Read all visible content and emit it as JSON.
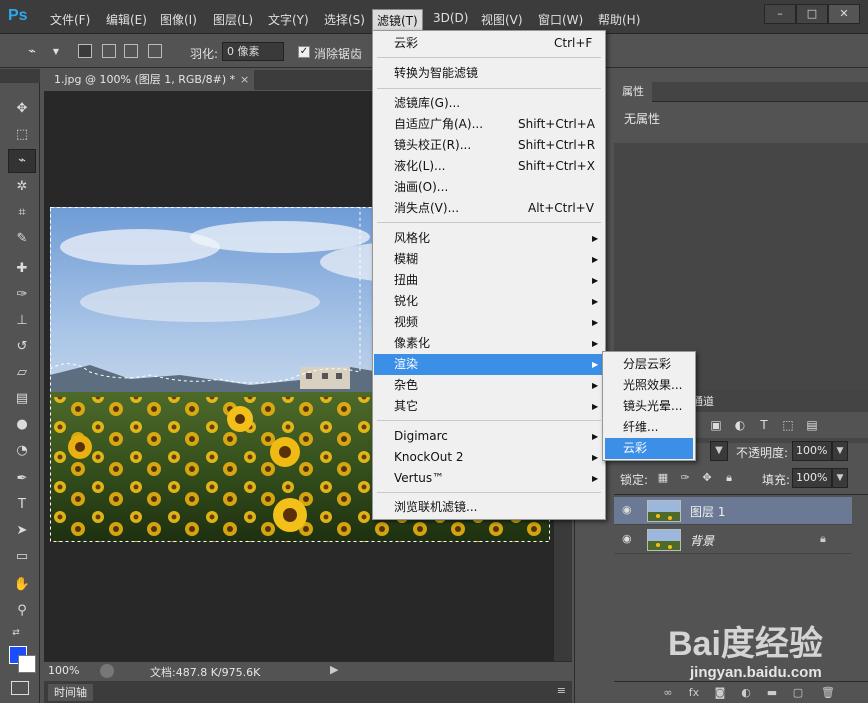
{
  "app": {
    "logo": "Ps",
    "window_controls": [
      "–",
      "□",
      "✕"
    ]
  },
  "menubar": {
    "items": [
      "文件(F)",
      "编辑(E)",
      "图像(I)",
      "图层(L)",
      "文字(Y)",
      "选择(S)",
      "滤镜(T)",
      "3D(D)",
      "视图(V)",
      "窗口(W)",
      "帮助(H)"
    ],
    "active_index": 6
  },
  "options": {
    "feather_label": "羽化:",
    "feather_value": "0 像素",
    "antialias_label": "消除锯齿",
    "antialias_checked": true
  },
  "document": {
    "tab_title": "1.jpg @ 100% (图层 1, RGB/8#) *",
    "tab_close": "×",
    "zoom": "100%",
    "doc_size": "文档:487.8 K/975.6K",
    "timeline_tab": "时间轴"
  },
  "filter_menu": {
    "groups": [
      [
        {
          "label": "云彩",
          "shortcut": "Ctrl+F"
        }
      ],
      [
        {
          "label": "转换为智能滤镜"
        }
      ],
      [
        {
          "label": "滤镜库(G)..."
        },
        {
          "label": "自适应广角(A)...",
          "shortcut": "Shift+Ctrl+A"
        },
        {
          "label": "镜头校正(R)...",
          "shortcut": "Shift+Ctrl+R"
        },
        {
          "label": "液化(L)...",
          "shortcut": "Shift+Ctrl+X"
        },
        {
          "label": "油画(O)..."
        },
        {
          "label": "消失点(V)...",
          "shortcut": "Alt+Ctrl+V"
        }
      ],
      [
        {
          "label": "风格化",
          "submenu": true
        },
        {
          "label": "模糊",
          "submenu": true
        },
        {
          "label": "扭曲",
          "submenu": true
        },
        {
          "label": "锐化",
          "submenu": true
        },
        {
          "label": "视频",
          "submenu": true
        },
        {
          "label": "像素化",
          "submenu": true
        },
        {
          "label": "渲染",
          "submenu": true,
          "highlight": true
        },
        {
          "label": "杂色",
          "submenu": true
        },
        {
          "label": "其它",
          "submenu": true
        }
      ],
      [
        {
          "label": "Digimarc",
          "submenu": true
        },
        {
          "label": "KnockOut 2",
          "submenu": true
        },
        {
          "label": "Vertus™",
          "submenu": true
        }
      ],
      [
        {
          "label": "浏览联机滤镜..."
        }
      ]
    ]
  },
  "render_submenu": {
    "items": [
      "分层云彩",
      "光照效果...",
      "镜头光晕...",
      "纤维...",
      "云彩"
    ],
    "highlight_index": 4
  },
  "properties": {
    "tab": "属性",
    "value": "无属性"
  },
  "layers": {
    "tab": "通道",
    "opacity_label": "不透明度:",
    "opacity_value": "100%",
    "lock_label": "锁定:",
    "fill_label": "填充:",
    "fill_value": "100%",
    "items": [
      {
        "name": "图层 1",
        "selected": true
      },
      {
        "name": "背景",
        "locked": true
      }
    ],
    "footer_icons": [
      "link-icon",
      "fx-icon",
      "mask-icon",
      "adjustment-icon",
      "folder-icon",
      "new-layer-icon",
      "trash-icon"
    ]
  },
  "watermark": {
    "brand": "Bai度经验",
    "url": "jingyan.baidu.com"
  },
  "colors": {
    "foreground": "#1a4dff",
    "background": "#ffffff",
    "menu_highlight": "#3c8fe6",
    "accent": "#2ba8f0"
  }
}
